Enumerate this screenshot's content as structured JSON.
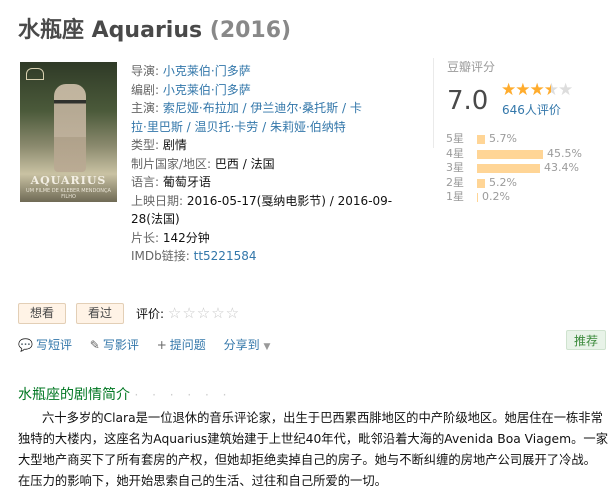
{
  "title": {
    "name": "水瓶座 Aquarius",
    "year": "(2016)"
  },
  "poster": {
    "title": "AQUARIUS",
    "subtitle": "UM FILME DE KLEBER MENDONÇA FILHO"
  },
  "info": {
    "director_label": "导演:",
    "director": "小克莱伯·门多萨",
    "writer_label": "编剧:",
    "writer": "小克莱伯·门多萨",
    "cast_label": "主演:",
    "cast_line1": "索尼娅·布拉加 / 伊兰迪尔·桑托斯 / 卡",
    "cast_line2": "拉·里巴斯 / 温贝托·卡劳 / 朱莉娅·伯纳特",
    "genre_label": "类型:",
    "genre": "剧情",
    "country_label": "制片国家/地区:",
    "country": "巴西 / 法国",
    "language_label": "语言:",
    "language": "葡萄牙语",
    "release_label": "上映日期:",
    "release_line1": "2016-05-17(戛纳电影节) / 2016-09-",
    "release_line2": "28(法国)",
    "runtime_label": "片长:",
    "runtime": "142分钟",
    "imdb_label": "IMDb链接:",
    "imdb": "tt5221584"
  },
  "rating": {
    "title": "豆瓣评分",
    "score": "7.0",
    "stars_value": 3.5,
    "votes": "646人评价",
    "distribution": [
      {
        "label": "5星",
        "pct": "5.7%",
        "value": 5.7
      },
      {
        "label": "4星",
        "pct": "45.5%",
        "value": 45.5
      },
      {
        "label": "3星",
        "pct": "43.4%",
        "value": 43.4
      },
      {
        "label": "2星",
        "pct": "5.2%",
        "value": 5.2
      },
      {
        "label": "1星",
        "pct": "0.2%",
        "value": 0.2
      }
    ]
  },
  "actions": {
    "wish": "想看",
    "did": "看过",
    "rate_label": "评价:",
    "short_review": "写短评",
    "review": "写影评",
    "question": "提问题",
    "share": "分享到",
    "recommend": "推荐"
  },
  "synopsis": {
    "heading": "水瓶座的剧情简介",
    "dots": "· · · · · ·",
    "text": "六十多岁的Clara是一位退休的音乐评论家，出生于巴西累西腓地区的中产阶级地区。她居住在一栋非常独特的大楼内，这座名为Aquarius建筑始建于上世纪40年代，毗邻沿着大海的Avenida Boa Viagem。一家大型地产商买下了所有套房的产权，但她却拒绝卖掉自己的房子。她与不断纠缠的房地产公司展开了冷战。在压力的影响下，她开始思索自己的生活、过往和自己所爱的一切。"
  }
}
